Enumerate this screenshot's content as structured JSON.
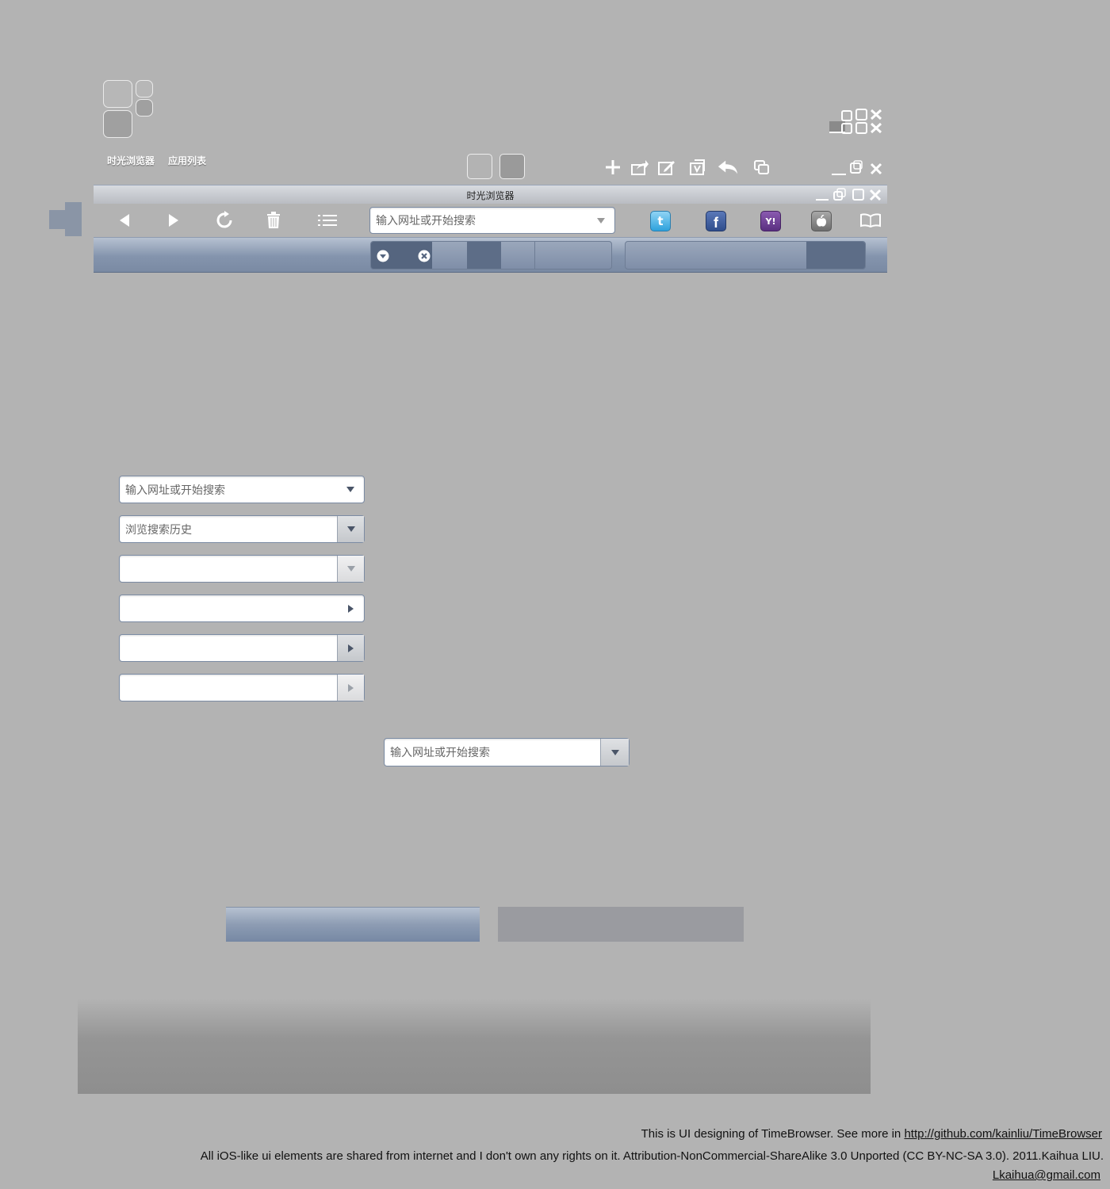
{
  "app_labels": {
    "browser": "时光浏览器",
    "app_list": "应用列表"
  },
  "window": {
    "title": "时光浏览器"
  },
  "url_bar": {
    "placeholder": "输入网址或开始搜索"
  },
  "samples": {
    "field1": "输入网址或开始搜索",
    "field2": "浏览搜索历史",
    "field3": "",
    "field4": "",
    "field5": "",
    "field6": "",
    "centered_field": "输入网址或开始搜索"
  },
  "footer": {
    "line1_prefix": "This is UI designing of TimeBrowser. See more in ",
    "line1_link": "http://github.com/kainliu/TimeBrowser",
    "line2": "All iOS-like ui elements are shared from internet and I don't own any rights on it.  Attribution-NonCommercial-ShareAlike 3.0 Unported (CC BY-NC-SA 3.0). 2011.Kaihua LIU.",
    "email": "Lkaihua@gmail.com"
  },
  "colors": {
    "background": "#b3b3b3",
    "tab_bar_top": "#b6c1d1",
    "tab_bar_bottom": "#7a8aa3",
    "active_tab": "#55657f",
    "twitter": "#4fb6e8",
    "facebook": "#3b5b9a",
    "yahoo": "#6a3b8f",
    "apple": "#8a8a8a"
  },
  "icons": [
    "tiles-icon",
    "window-controls-icon",
    "add-icon",
    "share-icon",
    "edit-icon",
    "bookmark-add-icon",
    "undo-icon",
    "copy-icon",
    "minimize-icon",
    "restore-icon",
    "maximize-icon",
    "close-icon",
    "back-icon",
    "forward-icon",
    "reload-icon",
    "trash-icon",
    "list-icon",
    "dropdown-icon",
    "twitter-icon",
    "facebook-icon",
    "yahoo-icon",
    "apple-icon",
    "book-icon",
    "side-tab-icon"
  ]
}
